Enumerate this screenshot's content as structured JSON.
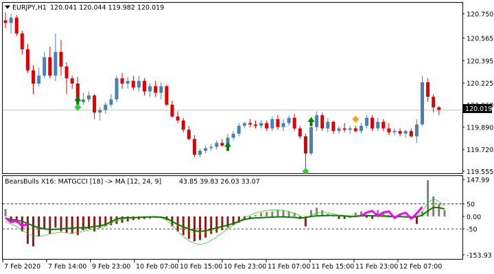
{
  "main_pane": {
    "symbol_label": "EURJPY,H1",
    "ohlc_text": "120.041 120.044 119.982 120.019",
    "current_price": "120.019",
    "price_ticks": [
      "120.750",
      "120.565",
      "120.395",
      "120.225",
      "120.060",
      "119.890",
      "119.720",
      "119.555"
    ],
    "colors": {
      "bull": "#4682b4",
      "bear": "#e00000",
      "price_line": "#c0c0c0",
      "arrow_up": "#008000",
      "marker_green": "#32cd32",
      "marker_orange": "#ffa500"
    }
  },
  "indicator_pane": {
    "title": "BearsBulls X16: MATGCCI [18] -> MA [12, 24, 9]",
    "values_text": "43.85 39.83 26.03 33.07",
    "ticks": [
      "147.99",
      "50",
      "0.00",
      "-50",
      "-153.93"
    ],
    "colors": {
      "bear_hist": "#8b1a1a",
      "bull_hist": "#808080",
      "ma_fast": "#008000",
      "ma_thin": "#32cd32",
      "signal_dots": "#d4d400",
      "highlight": "#ff00ff"
    }
  },
  "time_axis": [
    "7 Feb 2020",
    "7 Feb 14:00",
    "9 Feb 23:00",
    "10 Feb 07:00",
    "10 Feb 15:00",
    "10 Feb 23:00",
    "11 Feb 07:00",
    "11 Feb 15:00",
    "11 Feb 23:00",
    "12 Feb 07:00"
  ],
  "chart_data": {
    "type": "candlestick",
    "price_axis": {
      "min": 119.555,
      "max": 120.75
    },
    "indicator_axis": {
      "min": -153.93,
      "max": 147.99
    },
    "candles": [
      {
        "o": 120.7,
        "h": 120.76,
        "l": 120.64,
        "c": 120.68
      },
      {
        "o": 120.68,
        "h": 120.75,
        "l": 120.6,
        "c": 120.72
      },
      {
        "o": 120.72,
        "h": 120.74,
        "l": 120.58,
        "c": 120.6
      },
      {
        "o": 120.6,
        "h": 120.62,
        "l": 120.44,
        "c": 120.48
      },
      {
        "o": 120.48,
        "h": 120.52,
        "l": 120.3,
        "c": 120.32
      },
      {
        "o": 120.32,
        "h": 120.36,
        "l": 120.14,
        "c": 120.22
      },
      {
        "o": 120.22,
        "h": 120.34,
        "l": 120.2,
        "c": 120.28
      },
      {
        "o": 120.28,
        "h": 120.46,
        "l": 120.26,
        "c": 120.42
      },
      {
        "o": 120.42,
        "h": 120.5,
        "l": 120.26,
        "c": 120.28
      },
      {
        "o": 120.28,
        "h": 120.6,
        "l": 120.24,
        "c": 120.46
      },
      {
        "o": 120.46,
        "h": 120.55,
        "l": 120.28,
        "c": 120.35
      },
      {
        "o": 120.35,
        "h": 120.38,
        "l": 120.14,
        "c": 120.26
      },
      {
        "o": 120.26,
        "h": 120.28,
        "l": 120.18,
        "c": 120.22
      },
      {
        "o": 120.22,
        "h": 120.27,
        "l": 120.06,
        "c": 120.08
      },
      {
        "o": 120.08,
        "h": 120.15,
        "l": 120.06,
        "c": 120.1
      },
      {
        "o": 120.1,
        "h": 120.16,
        "l": 120.08,
        "c": 120.13
      },
      {
        "o": 120.13,
        "h": 120.14,
        "l": 119.95,
        "c": 120.0
      },
      {
        "o": 120.0,
        "h": 120.04,
        "l": 119.94,
        "c": 120.02
      },
      {
        "o": 120.02,
        "h": 120.08,
        "l": 119.99,
        "c": 120.06
      },
      {
        "o": 120.06,
        "h": 120.14,
        "l": 120.04,
        "c": 120.1
      },
      {
        "o": 120.1,
        "h": 120.28,
        "l": 120.08,
        "c": 120.26
      },
      {
        "o": 120.26,
        "h": 120.3,
        "l": 120.18,
        "c": 120.22
      },
      {
        "o": 120.22,
        "h": 120.27,
        "l": 120.18,
        "c": 120.24
      },
      {
        "o": 120.24,
        "h": 120.28,
        "l": 120.17,
        "c": 120.19
      },
      {
        "o": 120.19,
        "h": 120.28,
        "l": 120.16,
        "c": 120.24
      },
      {
        "o": 120.24,
        "h": 120.26,
        "l": 120.13,
        "c": 120.16
      },
      {
        "o": 120.16,
        "h": 120.22,
        "l": 120.12,
        "c": 120.2
      },
      {
        "o": 120.2,
        "h": 120.24,
        "l": 120.12,
        "c": 120.15
      },
      {
        "o": 120.15,
        "h": 120.23,
        "l": 120.1,
        "c": 120.2
      },
      {
        "o": 120.2,
        "h": 120.21,
        "l": 120.05,
        "c": 120.06
      },
      {
        "o": 120.06,
        "h": 120.09,
        "l": 119.96,
        "c": 119.97
      },
      {
        "o": 119.97,
        "h": 120.01,
        "l": 119.92,
        "c": 119.94
      },
      {
        "o": 119.94,
        "h": 119.96,
        "l": 119.85,
        "c": 119.87
      },
      {
        "o": 119.87,
        "h": 119.9,
        "l": 119.79,
        "c": 119.8
      },
      {
        "o": 119.8,
        "h": 119.83,
        "l": 119.66,
        "c": 119.68
      },
      {
        "o": 119.68,
        "h": 119.73,
        "l": 119.66,
        "c": 119.71
      },
      {
        "o": 119.71,
        "h": 119.75,
        "l": 119.69,
        "c": 119.73
      },
      {
        "o": 119.73,
        "h": 119.76,
        "l": 119.71,
        "c": 119.74
      },
      {
        "o": 119.74,
        "h": 119.79,
        "l": 119.72,
        "c": 119.77
      },
      {
        "o": 119.77,
        "h": 119.8,
        "l": 119.74,
        "c": 119.75
      },
      {
        "o": 119.75,
        "h": 119.84,
        "l": 119.73,
        "c": 119.81
      },
      {
        "o": 119.81,
        "h": 119.86,
        "l": 119.79,
        "c": 119.84
      },
      {
        "o": 119.84,
        "h": 119.92,
        "l": 119.82,
        "c": 119.9
      },
      {
        "o": 119.9,
        "h": 119.93,
        "l": 119.88,
        "c": 119.92
      },
      {
        "o": 119.92,
        "h": 119.95,
        "l": 119.89,
        "c": 119.91
      },
      {
        "o": 119.91,
        "h": 119.94,
        "l": 119.88,
        "c": 119.9
      },
      {
        "o": 119.9,
        "h": 119.94,
        "l": 119.88,
        "c": 119.92
      },
      {
        "o": 119.92,
        "h": 119.94,
        "l": 119.86,
        "c": 119.88
      },
      {
        "o": 119.88,
        "h": 119.97,
        "l": 119.86,
        "c": 119.95
      },
      {
        "o": 119.95,
        "h": 119.98,
        "l": 119.87,
        "c": 119.89
      },
      {
        "o": 119.89,
        "h": 119.95,
        "l": 119.86,
        "c": 119.92
      },
      {
        "o": 119.92,
        "h": 119.98,
        "l": 119.9,
        "c": 119.96
      },
      {
        "o": 119.96,
        "h": 119.99,
        "l": 119.86,
        "c": 119.88
      },
      {
        "o": 119.88,
        "h": 119.9,
        "l": 119.8,
        "c": 119.82
      },
      {
        "o": 119.82,
        "h": 119.84,
        "l": 119.58,
        "c": 119.69
      },
      {
        "o": 119.69,
        "h": 119.91,
        "l": 119.68,
        "c": 119.89
      },
      {
        "o": 119.89,
        "h": 120.01,
        "l": 119.86,
        "c": 119.98
      },
      {
        "o": 119.98,
        "h": 120.0,
        "l": 119.86,
        "c": 119.88
      },
      {
        "o": 119.88,
        "h": 119.96,
        "l": 119.85,
        "c": 119.93
      },
      {
        "o": 119.93,
        "h": 119.94,
        "l": 119.84,
        "c": 119.86
      },
      {
        "o": 119.86,
        "h": 119.9,
        "l": 119.84,
        "c": 119.88
      },
      {
        "o": 119.88,
        "h": 119.92,
        "l": 119.85,
        "c": 119.87
      },
      {
        "o": 119.87,
        "h": 119.9,
        "l": 119.84,
        "c": 119.88
      },
      {
        "o": 119.88,
        "h": 119.9,
        "l": 119.85,
        "c": 119.86
      },
      {
        "o": 119.86,
        "h": 119.92,
        "l": 119.84,
        "c": 119.9
      },
      {
        "o": 119.9,
        "h": 119.98,
        "l": 119.88,
        "c": 119.96
      },
      {
        "o": 119.96,
        "h": 119.98,
        "l": 119.86,
        "c": 119.88
      },
      {
        "o": 119.88,
        "h": 119.96,
        "l": 119.86,
        "c": 119.93
      },
      {
        "o": 119.93,
        "h": 119.95,
        "l": 119.86,
        "c": 119.88
      },
      {
        "o": 119.88,
        "h": 119.92,
        "l": 119.83,
        "c": 119.85
      },
      {
        "o": 119.85,
        "h": 119.88,
        "l": 119.83,
        "c": 119.86
      },
      {
        "o": 119.86,
        "h": 119.88,
        "l": 119.82,
        "c": 119.84
      },
      {
        "o": 119.84,
        "h": 119.87,
        "l": 119.81,
        "c": 119.86
      },
      {
        "o": 119.86,
        "h": 119.88,
        "l": 119.81,
        "c": 119.82
      },
      {
        "o": 119.82,
        "h": 119.95,
        "l": 119.77,
        "c": 119.91
      },
      {
        "o": 119.91,
        "h": 120.28,
        "l": 119.9,
        "c": 120.23
      },
      {
        "o": 120.23,
        "h": 120.26,
        "l": 120.08,
        "c": 120.12
      },
      {
        "o": 120.12,
        "h": 120.14,
        "l": 120.0,
        "c": 120.04
      },
      {
        "o": 120.04,
        "h": 120.05,
        "l": 119.98,
        "c": 120.02
      }
    ],
    "hist": [
      30,
      -20,
      -25,
      -60,
      -110,
      -120,
      -80,
      -50,
      -70,
      -45,
      -60,
      -65,
      -70,
      -75,
      -55,
      -50,
      -60,
      -45,
      -40,
      -35,
      -30,
      -25,
      -20,
      -15,
      -12,
      -10,
      -8,
      -6,
      -5,
      -15,
      -40,
      -60,
      -75,
      -90,
      -100,
      -95,
      -85,
      -70,
      -65,
      -55,
      -45,
      -35,
      -25,
      -15,
      -10,
      5,
      15,
      18,
      20,
      25,
      25,
      20,
      15,
      -10,
      -40,
      25,
      35,
      25,
      10,
      5,
      -10,
      -10,
      -5,
      15,
      20,
      -5,
      -10,
      25,
      20,
      5,
      -5,
      10,
      -5,
      -10,
      -30,
      20,
      145,
      80,
      50,
      25
    ],
    "ma_fast": [
      -8,
      -12,
      -15,
      -20,
      -28,
      -38,
      -45,
      -50,
      -52,
      -52,
      -50,
      -48,
      -47,
      -45,
      -45,
      -44,
      -40,
      -38,
      -32,
      -22,
      -10,
      -6,
      -5,
      -5,
      -4,
      -3,
      -2,
      -2,
      -3,
      -8,
      -20,
      -32,
      -42,
      -50,
      -58,
      -60,
      -58,
      -52,
      -46,
      -40,
      -35,
      -28,
      -20,
      -12,
      -8,
      -6,
      -5,
      -4,
      -3,
      -2,
      -2,
      -3,
      -4,
      -6,
      -5,
      0,
      2,
      3,
      4,
      4,
      3,
      2,
      0,
      0,
      2,
      3,
      2,
      2,
      1,
      0,
      -1,
      -1,
      -2,
      -3,
      -2,
      5,
      22,
      36,
      35,
      30
    ],
    "ma_thin": [
      -20,
      -30,
      -40,
      -55,
      -70,
      -78,
      -80,
      -76,
      -70,
      -66,
      -64,
      -66,
      -67,
      -64,
      -60,
      -55,
      -50,
      -45,
      -38,
      -28,
      -18,
      -10,
      -8,
      -6,
      -4,
      -3,
      -3,
      -4,
      -5,
      -15,
      -35,
      -60,
      -80,
      -98,
      -108,
      -112,
      -108,
      -96,
      -82,
      -66,
      -50,
      -35,
      -20,
      -5,
      5,
      14,
      20,
      24,
      26,
      26,
      24,
      20,
      12,
      2,
      -8,
      5,
      14,
      18,
      16,
      10,
      4,
      0,
      -2,
      2,
      6,
      6,
      4,
      6,
      6,
      2,
      -2,
      -2,
      -3,
      -5,
      2,
      20,
      55,
      70,
      60,
      42
    ],
    "signal_dots": [
      -10,
      -18,
      -25,
      -34,
      -42,
      -48,
      -52,
      -54,
      -53,
      -52,
      -50,
      -49,
      -48,
      -48,
      -47,
      -45,
      -42,
      -38,
      -32,
      -26,
      -18,
      -12,
      -9,
      -8,
      -6,
      -5,
      -4,
      -4,
      -6,
      -12,
      -24,
      -38,
      -50,
      -60,
      -66,
      -68,
      -66,
      -60,
      -54,
      -46,
      -38,
      -30,
      -22,
      -14,
      -6,
      2,
      8,
      12,
      16,
      18,
      18,
      16,
      12,
      6,
      2,
      6,
      10,
      12,
      12,
      10,
      8,
      6,
      4,
      4,
      6,
      6,
      5,
      5,
      4,
      3,
      2,
      1,
      0,
      -1,
      0,
      8,
      28,
      44,
      46,
      40
    ],
    "magenta_segments": [
      [
        0,
        4
      ],
      [
        64,
        75
      ]
    ],
    "up_arrows": [
      {
        "i": 13,
        "price": 120.09
      },
      {
        "i": 40,
        "price": 119.74
      },
      {
        "i": 55,
        "price": 119.93
      }
    ],
    "green_markers": [
      {
        "i": 13,
        "price": 120.04
      },
      {
        "i": 54,
        "price": 119.555
      }
    ],
    "orange_markers": [
      {
        "i": 63,
        "price": 119.95
      }
    ]
  }
}
